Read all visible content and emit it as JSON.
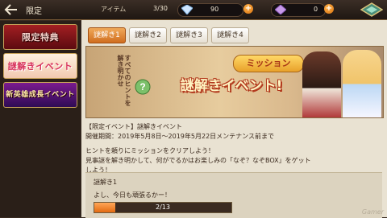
{
  "header": {
    "title": "限定",
    "item_label": "アイテム",
    "item_count": "3/30",
    "crystal_value": "90",
    "ticket_value": "0"
  },
  "left_banners": [
    {
      "label": "限定特典"
    },
    {
      "label": "謎解きイベント"
    },
    {
      "label": "新英雄成長イベント"
    }
  ],
  "tabs": [
    {
      "label": "謎解き1",
      "active": true
    },
    {
      "label": "謎解き2",
      "active": false
    },
    {
      "label": "謎解き3",
      "active": false
    },
    {
      "label": "謎解き4",
      "active": false
    }
  ],
  "hero": {
    "hint": "すべてのヒントを解き明かせ",
    "sub": "ミッション",
    "main": "謎解きイベント!"
  },
  "description": {
    "line1": "【限定イベント】謎解きイベント",
    "line2": "開催期間：2019年5月8日～2019年5月22日メンテナンス前まで",
    "line3": "ヒントを頼りにミッションをクリアしよう！",
    "line4": "見事謎を解き明かして、何がでるかはお楽しみの「なぞ？なぞBOX」をゲット",
    "line5": "しよう！"
  },
  "mission": {
    "title": "謎解き1",
    "text": "よし、今日も頑張るかー！",
    "progress_text": "2/13",
    "progress_fraction": 0.154
  },
  "watermark": "Gamer",
  "colors": {
    "accent": "#d06d1e",
    "topbar": "#2a2019",
    "panel": "#e9e2d2"
  }
}
